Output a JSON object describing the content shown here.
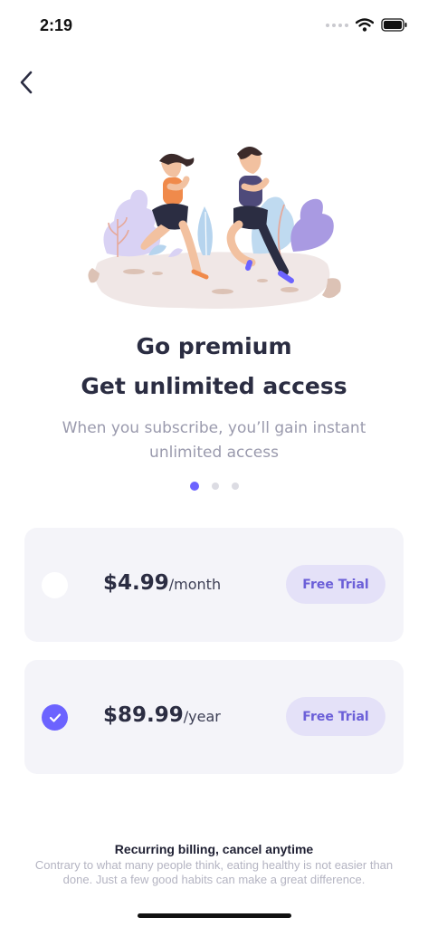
{
  "status_bar": {
    "time": "2:19"
  },
  "header": {
    "back_icon": "chevron-left-icon"
  },
  "hero": {
    "illustration": "jogging-couple-illustration",
    "title_line1": "Go premium",
    "title_line2": "Get unlimited access",
    "subtitle": "When you subscribe, you’ll gain instant unlimited access"
  },
  "pager": {
    "total": 3,
    "active_index": 0
  },
  "plans": [
    {
      "price": "$4.99",
      "period": "/month",
      "button_label": "Free Trial",
      "selected": false
    },
    {
      "price": "$89.99",
      "period": "/year",
      "button_label": "Free Trial",
      "selected": true
    }
  ],
  "footer": {
    "billing_title": "Recurring billing, cancel anytime",
    "billing_desc": "Contrary to what many people think, eating healthy is not easier than done. Just a few good habits can make a great difference."
  },
  "colors": {
    "accent": "#6c63ff",
    "button_bg": "#e4e1f8",
    "card_bg": "#f4f4f9",
    "title": "#2b2d42",
    "muted": "#9a9aad"
  }
}
